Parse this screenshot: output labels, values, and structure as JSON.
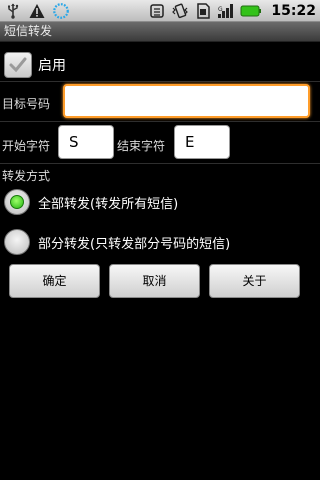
{
  "statusbar": {
    "time": "15:22",
    "icons": [
      "usb-icon",
      "warning-icon",
      "sync-icon",
      "wifi-icon",
      "vibrate-icon",
      "sdcard-icon",
      "signal-icon",
      "battery-icon"
    ]
  },
  "app": {
    "title": "短信转发"
  },
  "form": {
    "enable_label": "启用",
    "enable_checked": true,
    "target_label": "目标号码",
    "target_value": "",
    "start_label": "开始字符",
    "start_value": "S",
    "end_label": "结束字符",
    "end_value": "E",
    "mode_label": "转发方式",
    "radio_all_label": "全部转发(转发所有短信)",
    "radio_partial_label": "部分转发(只转发部分号码的短信)",
    "selected_mode": "all"
  },
  "buttons": {
    "ok": "确定",
    "cancel": "取消",
    "about": "关于"
  },
  "colors": {
    "focus_border": "#ff9d2a",
    "radio_selected": "#22b30f",
    "battery": "#34c21a"
  }
}
